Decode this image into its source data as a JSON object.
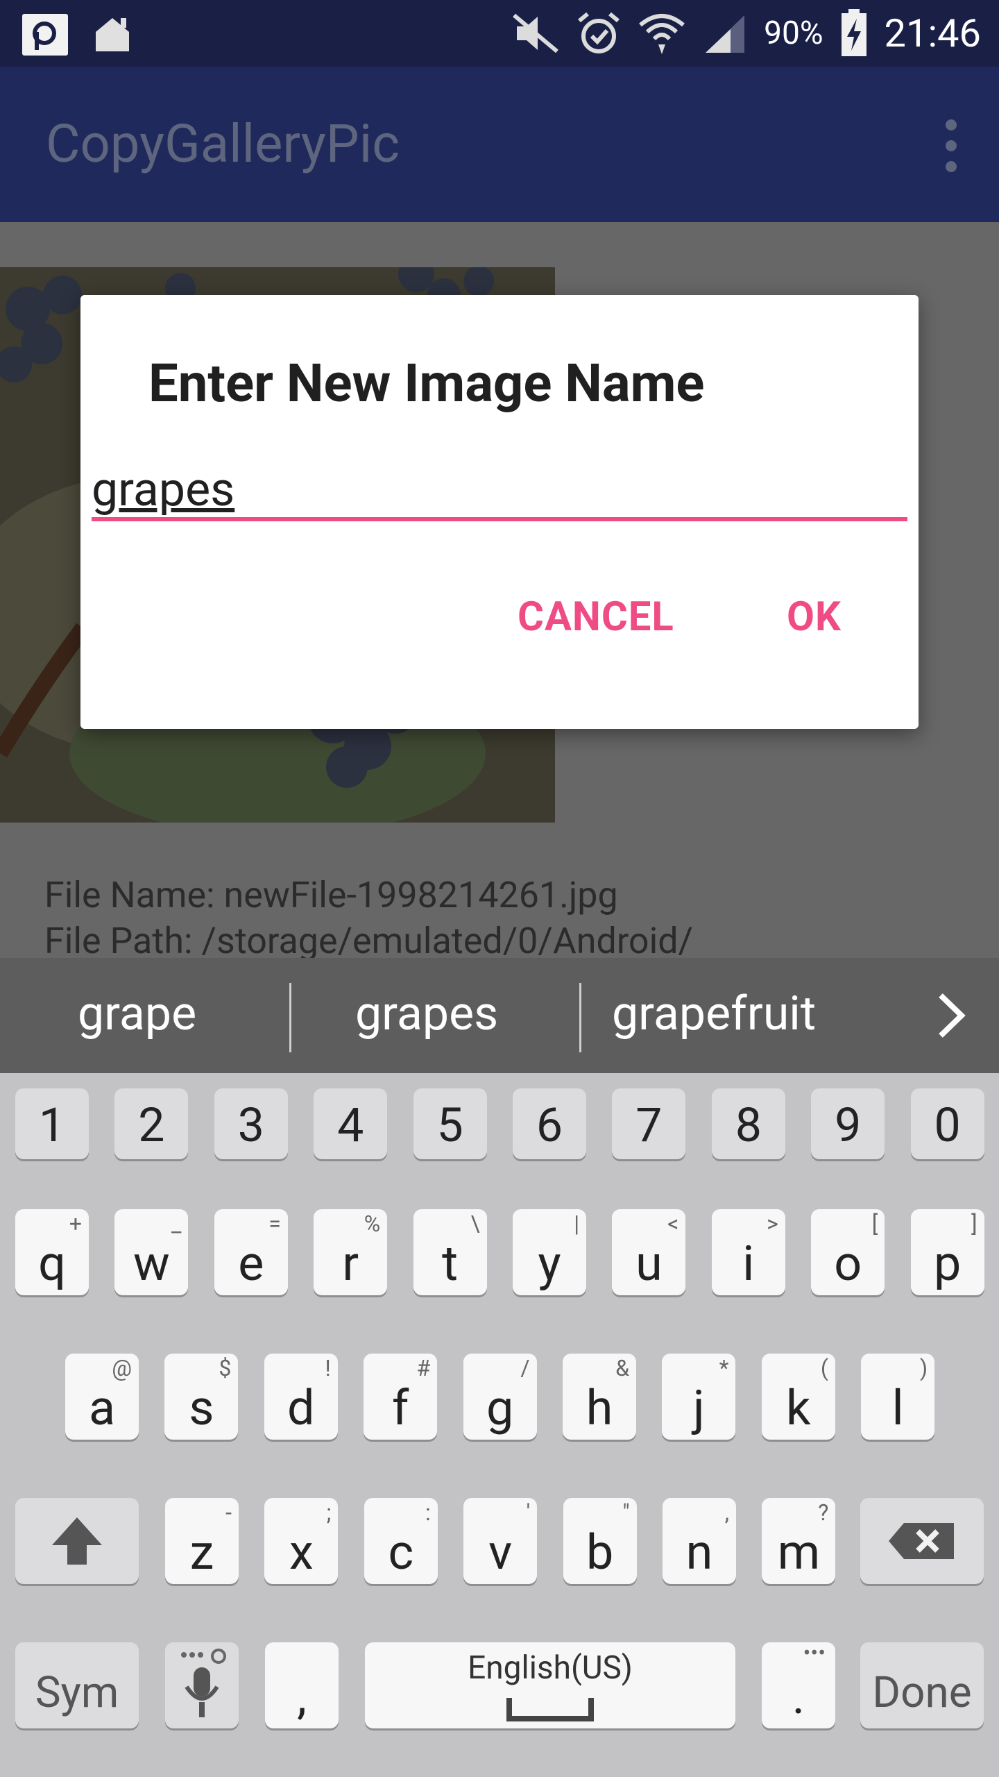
{
  "status_bar": {
    "battery": "90%",
    "time": "21:46"
  },
  "app_bar": {
    "title": "CopyGalleryPic"
  },
  "content": {
    "file_name_line": "File Name: newFile-1998214261.jpg",
    "file_path_line": "File Path: /storage/emulated/0/Android/"
  },
  "dialog": {
    "title": "Enter New Image Name",
    "input_value": "grapes",
    "cancel_label": "CANCEL",
    "ok_label": "OK"
  },
  "suggestions": [
    "grape",
    "grapes",
    "grapefruit"
  ],
  "keyboard": {
    "numbers": [
      "1",
      "2",
      "3",
      "4",
      "5",
      "6",
      "7",
      "8",
      "9",
      "0"
    ],
    "row1": [
      {
        "k": "q",
        "s": "+"
      },
      {
        "k": "w",
        "s": "_"
      },
      {
        "k": "e",
        "s": "="
      },
      {
        "k": "r",
        "s": "%"
      },
      {
        "k": "t",
        "s": "\\"
      },
      {
        "k": "y",
        "s": "|"
      },
      {
        "k": "u",
        "s": "<"
      },
      {
        "k": "i",
        "s": ">"
      },
      {
        "k": "o",
        "s": "["
      },
      {
        "k": "p",
        "s": "]"
      }
    ],
    "row2": [
      {
        "k": "a",
        "s": "@"
      },
      {
        "k": "s",
        "s": "$"
      },
      {
        "k": "d",
        "s": "!"
      },
      {
        "k": "f",
        "s": "#"
      },
      {
        "k": "g",
        "s": "/"
      },
      {
        "k": "h",
        "s": "&"
      },
      {
        "k": "j",
        "s": "*"
      },
      {
        "k": "k",
        "s": "("
      },
      {
        "k": "l",
        "s": ")"
      }
    ],
    "row3": [
      {
        "k": "z",
        "s": "-"
      },
      {
        "k": "x",
        "s": ";"
      },
      {
        "k": "c",
        "s": ":"
      },
      {
        "k": "v",
        "s": "'"
      },
      {
        "k": "b",
        "s": "\""
      },
      {
        "k": "n",
        "s": ","
      },
      {
        "k": "m",
        "s": "?"
      }
    ],
    "sym_label": "Sym",
    "comma_label": ",",
    "space_label": "English(US)",
    "period_label": ".",
    "done_label": "Done"
  }
}
